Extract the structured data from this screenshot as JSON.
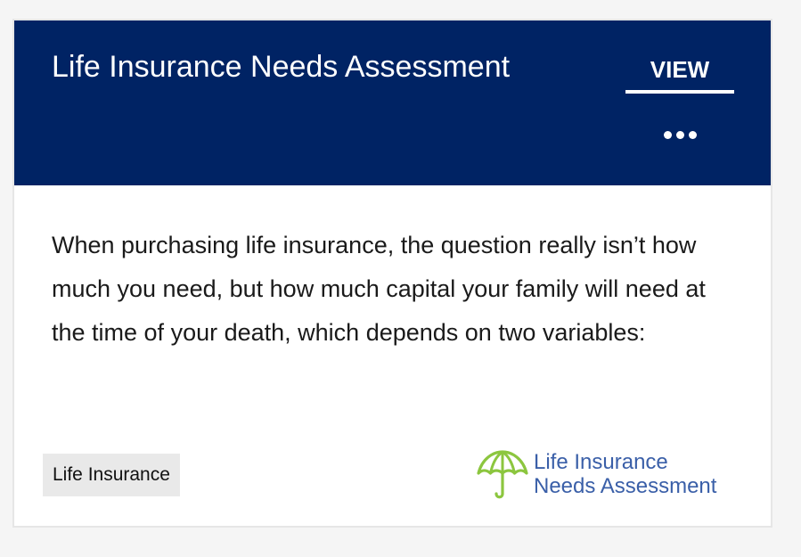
{
  "card": {
    "title": "Life Insurance Needs Assessment",
    "view_label": "VIEW",
    "more_icon": "more-horizontal-icon",
    "description": "When purchasing life insurance, the question really isn’t how much you need, but how much capital your family will need at the time of your death, which depends on two variables:",
    "tag_label": "Life Insurance",
    "logo": {
      "icon": "umbrella-icon",
      "line1": "Life Insurance",
      "line2": "Needs Assessment"
    }
  },
  "colors": {
    "header_background": "#002364",
    "header_text": "#ffffff",
    "body_text": "#1a1a1a",
    "tag_background": "#e9e9e9",
    "logo_icon": "#8cc63f",
    "logo_text": "#3a5fa8"
  }
}
